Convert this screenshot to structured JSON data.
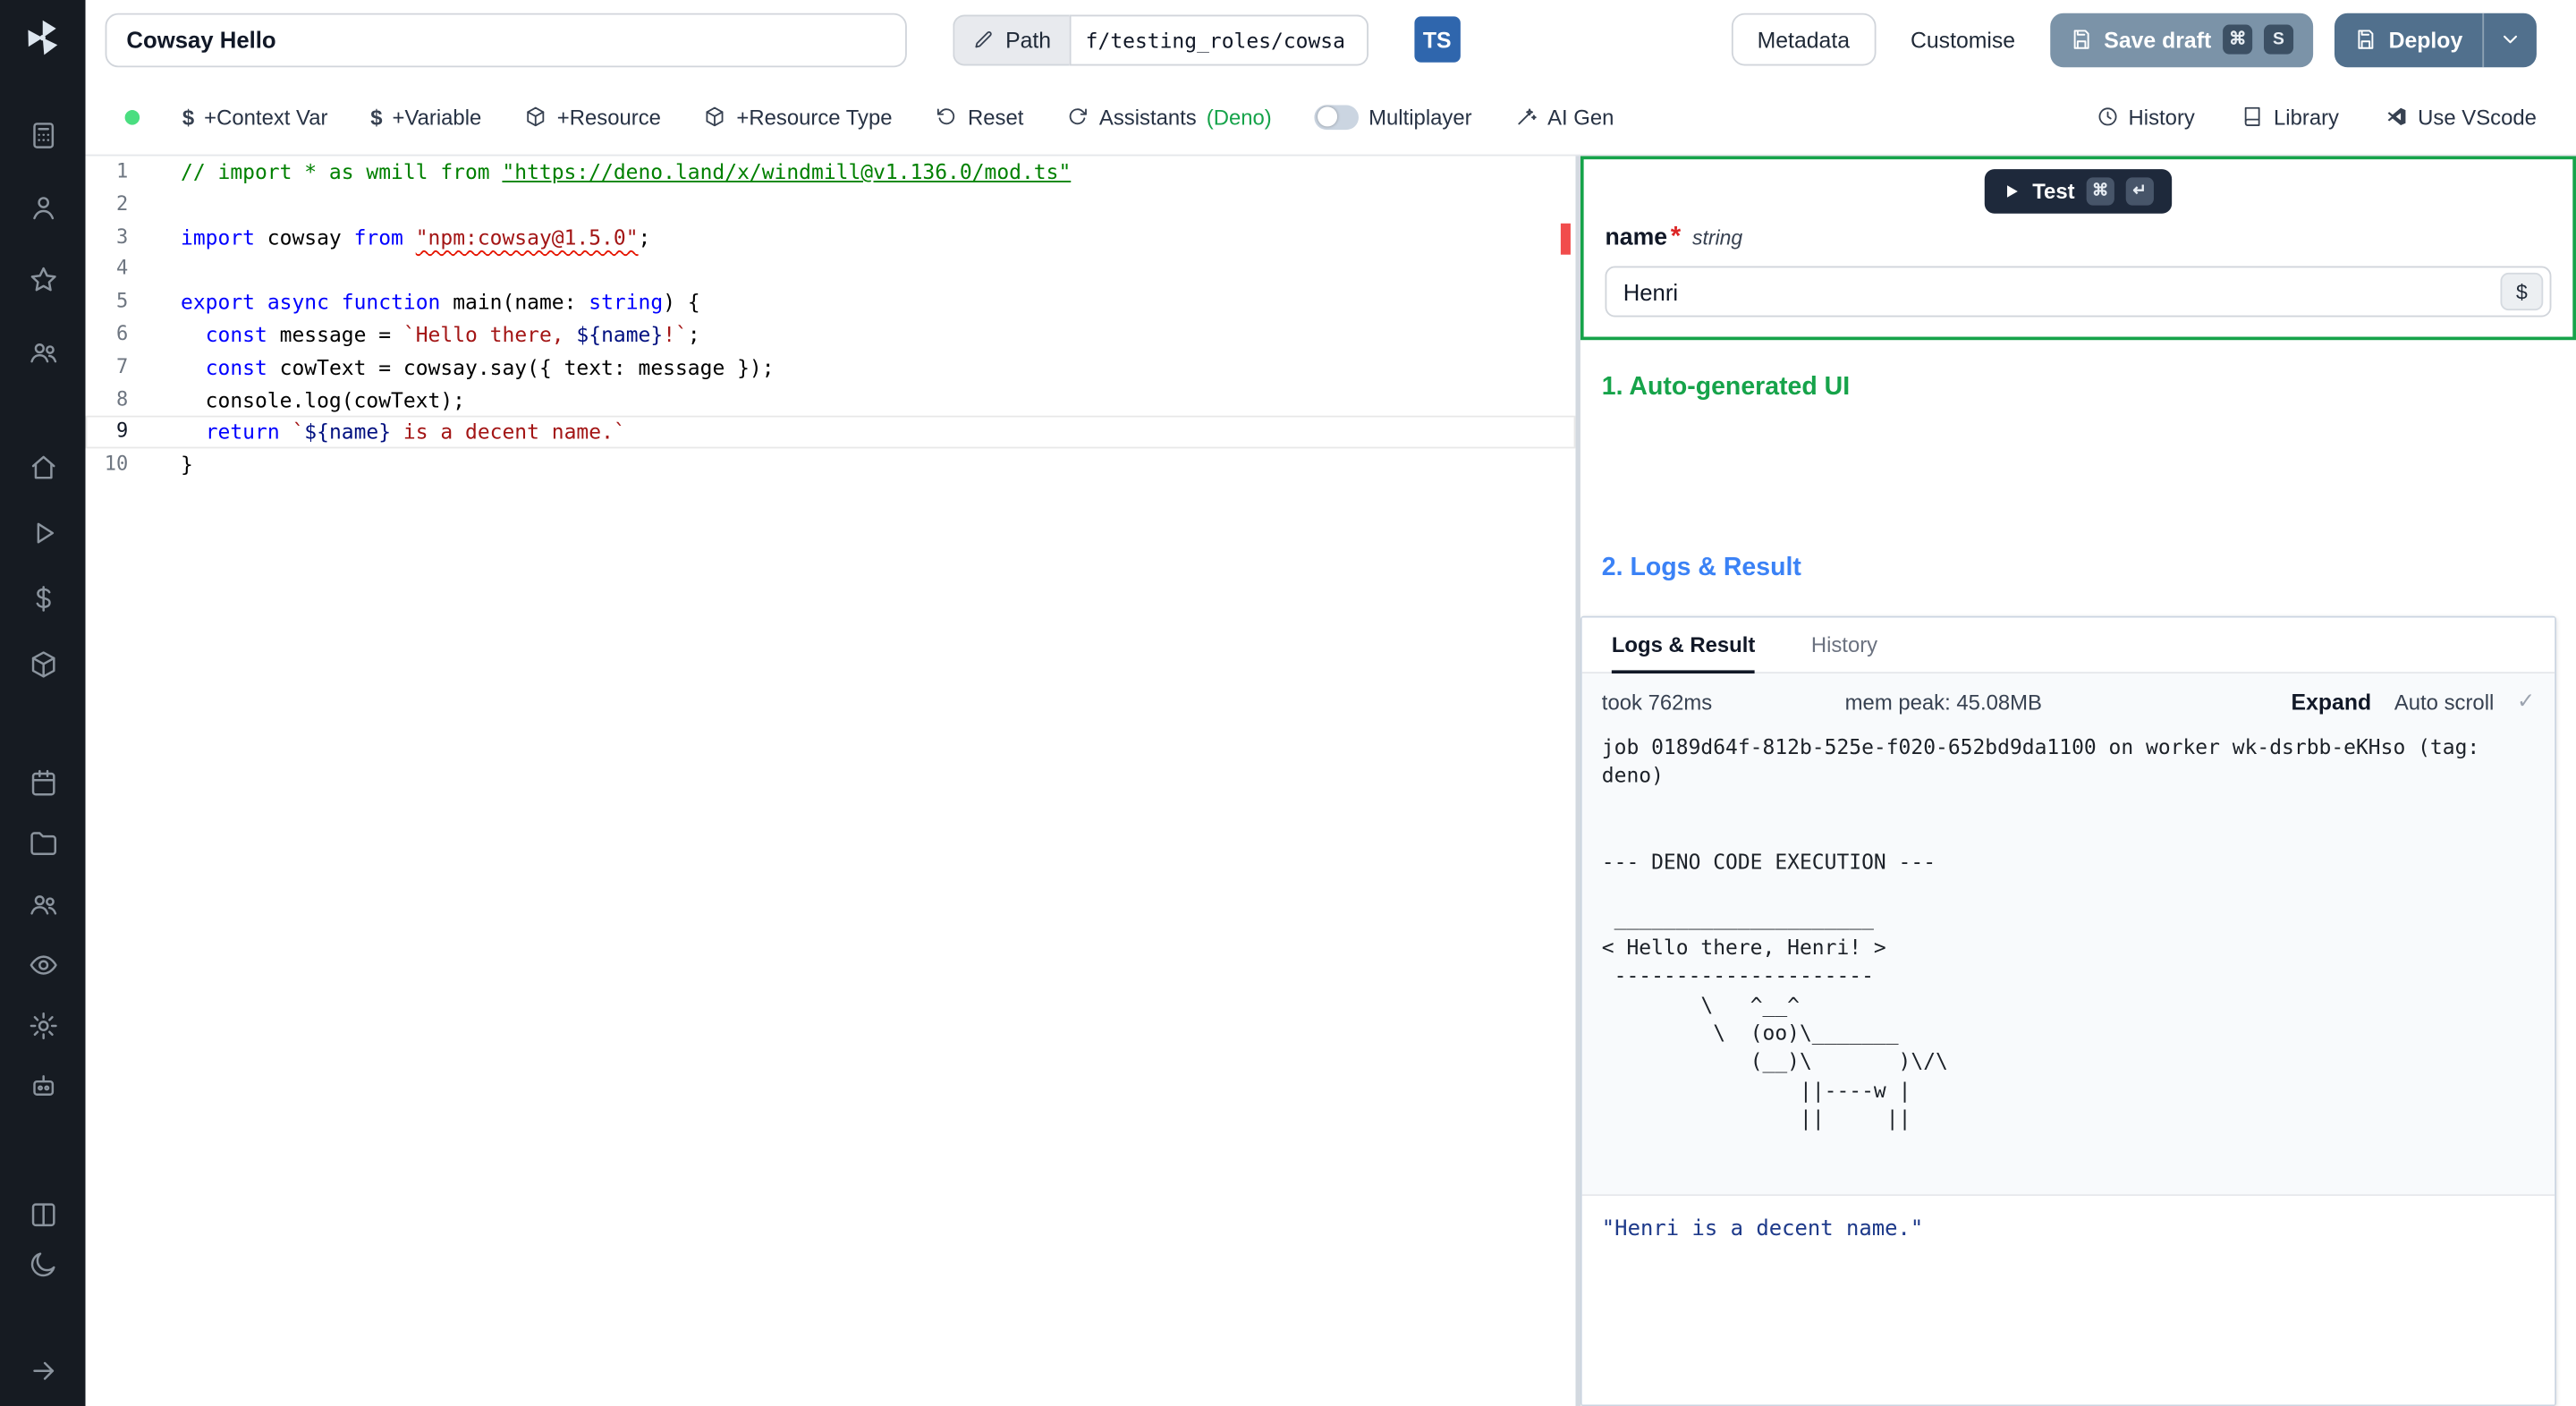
{
  "sidebar": {
    "icons": [
      "windmill-logo",
      "apps",
      "user",
      "star",
      "users",
      "home",
      "runs",
      "variables",
      "resources",
      "schedules",
      "folders",
      "groups",
      "audit-logs",
      "settings",
      "workers",
      "docs",
      "dark-mode",
      "expand"
    ]
  },
  "topbar": {
    "script_name": "Cowsay Hello",
    "path_label": "Path",
    "path_value": "f/testing_roles/cowsa",
    "lang_badge": "TS",
    "metadata": "Metadata",
    "customise": "Customise",
    "save_draft": "Save draft",
    "save_kbd_mod": "⌘",
    "save_kbd_key": "S",
    "deploy": "Deploy"
  },
  "toolbar": {
    "context_var": "+Context Var",
    "variable": "+Variable",
    "resource": "+Resource",
    "resource_type": "+Resource Type",
    "reset": "Reset",
    "assistants": "Assistants",
    "assistants_lang": "(Deno)",
    "multiplayer": "Multiplayer",
    "ai_gen": "AI Gen",
    "history": "History",
    "library": "Library",
    "vscode": "Use VScode",
    "dollar": "$"
  },
  "editor": {
    "lines": [
      {
        "n": "1",
        "tokens": [
          "// import * as wmill from ",
          "\"https://deno.land/x/windmill@v1.136.0/mod.ts\""
        ]
      },
      {
        "n": "2",
        "tokens": []
      },
      {
        "n": "3",
        "tokens": [
          "import",
          " cowsay ",
          "from",
          " ",
          "\"npm:cowsay@1.5.0\"",
          ";"
        ]
      },
      {
        "n": "4",
        "tokens": []
      },
      {
        "n": "5",
        "tokens": [
          "export",
          " ",
          "async",
          " ",
          "function",
          " main(name: ",
          "string",
          ") {"
        ]
      },
      {
        "n": "6",
        "tokens": [
          "  ",
          "const",
          " message = ",
          "`Hello there, ",
          "${name}",
          "!`",
          ";"
        ]
      },
      {
        "n": "7",
        "tokens": [
          "  ",
          "const",
          " cowText = cowsay.say({ text: message });"
        ]
      },
      {
        "n": "8",
        "tokens": [
          "  console.log(cowText);"
        ]
      },
      {
        "n": "9",
        "tokens": [
          "  ",
          "return",
          " ",
          "`",
          "${name}",
          " is a decent name.`"
        ]
      },
      {
        "n": "10",
        "tokens": [
          "}"
        ]
      }
    ]
  },
  "run": {
    "test": "Test",
    "kbd_mod": "⌘",
    "kbd_enter": "↵",
    "field_name": "name",
    "required": "*",
    "field_type": "string",
    "field_value": "Henri",
    "insert_var": "$"
  },
  "sections": {
    "ui": "1. Auto-generated UI",
    "logs": "2. Logs & Result"
  },
  "logs": {
    "tab_logs": "Logs & Result",
    "tab_history": "History",
    "took": "took 762ms",
    "mem": "mem peak: 45.08MB",
    "expand": "Expand",
    "autoscroll": "Auto scroll",
    "check": "✓",
    "text": "job 0189d64f-812b-525e-f020-652bd9da1100 on worker wk-dsrbb-eKHso (tag: deno)\n\n\n--- DENO CODE EXECUTION ---\n\n _____________________\n< Hello there, Henri! >\n ---------------------\n        \\   ^__^\n         \\  (oo)\\_______\n            (__)\\       )\\/\\\n                ||----w |\n                ||     ||",
    "result": "\"Henri is a decent name.\""
  }
}
